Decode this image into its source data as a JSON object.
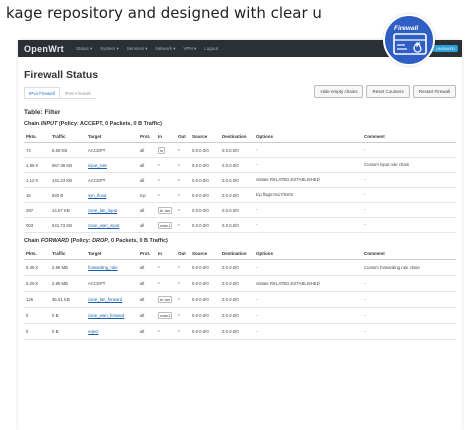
{
  "caption": "kage repository and designed with clear u",
  "navbar": {
    "brand": "OpenWrt",
    "items": [
      "Status ▾",
      "System ▾",
      "Services ▾",
      "Network ▾",
      "VPN ▾",
      "Logout"
    ],
    "badge": "UNSAVED"
  },
  "page": {
    "title": "Firewall Status",
    "tabs": [
      "IPv4 Firewall",
      "IPv6 Firewall"
    ],
    "buttons": [
      "Hide empty chains",
      "Reset Counters",
      "Restart Firewall"
    ]
  },
  "table_label": "Table: Filter",
  "logo_text": "Firewall",
  "chain_input": {
    "name": "INPUT",
    "title_prefix": "Chain ",
    "title_suffix": " (Policy: ACCEPT, 0 Packets, 0 B Traffic)",
    "columns": [
      "Pkts.",
      "Traffic",
      "Target",
      "Prot.",
      "In",
      "Out",
      "Source",
      "Destination",
      "Options",
      "Comment"
    ],
    "rows": [
      [
        "74",
        "5.69 KB",
        "ACCEPT",
        "all",
        "lo",
        "*",
        "0.0.0.0/0",
        "0.0.0.0/0",
        "-",
        "-"
      ],
      [
        "1.86 K",
        "667.38 KB",
        "input_rule",
        "all",
        "*",
        "*",
        "0.0.0.0/0",
        "0.0.0.0/0",
        "-",
        "Custom input rule chain"
      ],
      [
        "1.12 K",
        "141.23 KB",
        "ACCEPT",
        "all",
        "*",
        "*",
        "0.0.0.0/0",
        "0.0.0.0/0",
        "ctstate RELATED,ESTABLISHED",
        "-"
      ],
      [
        "15",
        "840 B",
        "syn_flood",
        "tcp",
        "*",
        "*",
        "0.0.0.0/0",
        "0.0.0.0/0",
        "tcp flags:0x17/0x02",
        "-"
      ],
      [
        "287",
        "14.57 KB",
        "zone_lan_input",
        "all",
        "br-lan",
        "*",
        "0.0.0.0/0",
        "0.0.0.0/0",
        "-",
        "-"
      ],
      [
        "003",
        "541.73 KB",
        "zone_wan_input",
        "all",
        "wlan1",
        "*",
        "0.0.0.0/0",
        "0.0.0.0/0",
        "-",
        "-"
      ]
    ]
  },
  "chain_forward": {
    "name": "FORWARD",
    "title_prefix": "Chain ",
    "title_mid": " (Policy: ",
    "policy": "DROP",
    "title_suffix": ", 0 Packets, 0 B Traffic)",
    "columns": [
      "Pkts.",
      "Traffic",
      "Target",
      "Prot.",
      "In",
      "Out",
      "Source",
      "Destination",
      "Options",
      "Comment"
    ],
    "rows": [
      [
        "5.36 K",
        "2.98 MB",
        "forwarding_rule",
        "all",
        "*",
        "*",
        "0.0.0.0/0",
        "0.0.0.0/0",
        "-",
        "Custom forwarding rule chain"
      ],
      [
        "5.20 K",
        "2.90 MB",
        "ACCEPT",
        "all",
        "*",
        "*",
        "0.0.0.0/0",
        "0.0.0.0/0",
        "ctstate RELATED,ESTABLISHED",
        "-"
      ],
      [
        "126",
        "36.01 KB",
        "zone_lan_forward",
        "all",
        "br-lan",
        "*",
        "0.0.0.0/0",
        "0.0.0.0/0",
        "-",
        "-"
      ],
      [
        "0",
        "0 B",
        "zone_wan_forward",
        "all",
        "wlan1",
        "*",
        "0.0.0.0/0",
        "0.0.0.0/0",
        "-",
        "-"
      ],
      [
        "0",
        "0 B",
        "reject",
        "all",
        "*",
        "*",
        "0.0.0.0/0",
        "0.0.0.0/0",
        "-",
        "-"
      ]
    ]
  }
}
